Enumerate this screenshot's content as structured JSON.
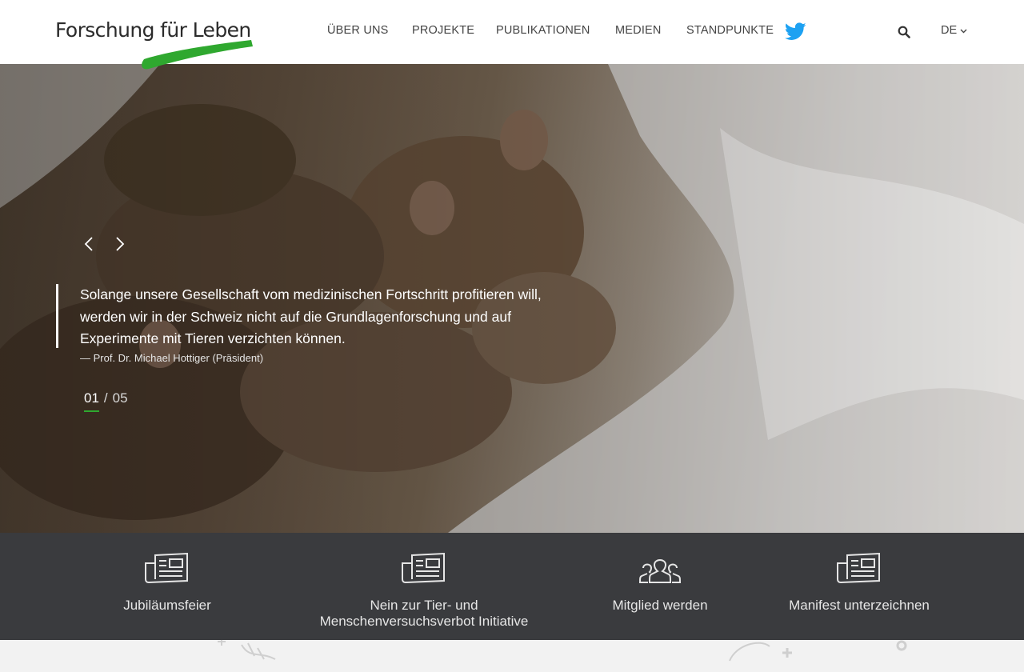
{
  "brand": {
    "logo_text": "Forschung für Leben",
    "accent_color": "#2fa82f"
  },
  "nav": {
    "items": [
      {
        "label": "ÜBER UNS"
      },
      {
        "label": "PROJEKTE"
      },
      {
        "label": "PUBLIKATIONEN"
      },
      {
        "label": "MEDIEN"
      },
      {
        "label": "STANDPUNKTE"
      }
    ],
    "twitter_icon": "twitter-icon",
    "search_icon": "search-icon",
    "language": "DE"
  },
  "hero": {
    "quote": "Solange unsere Gesellschaft vom medizinischen Fortschritt profitieren will, werden wir in der Schweiz nicht auf die Grundlagenforschung und auf Experimente mit Tieren verzichten können.",
    "cite": "— Prof. Dr. Michael Hottiger (Präsident)",
    "slide_current": "01",
    "slide_separator": "/",
    "slide_total": "05"
  },
  "features": [
    {
      "label": "Jubiläumsfeier",
      "icon": "newspaper-icon"
    },
    {
      "label": "Nein zur Tier- und Menschenversuchsverbot Initiative",
      "icon": "newspaper-icon"
    },
    {
      "label": "Mitglied werden",
      "icon": "group-icon"
    },
    {
      "label": "Manifest unterzeichnen",
      "icon": "newspaper-icon"
    }
  ]
}
